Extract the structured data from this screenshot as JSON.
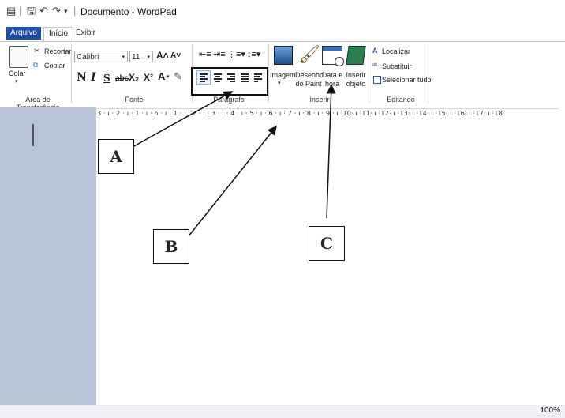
{
  "window": {
    "title": "Documento - WordPad"
  },
  "tabs": [
    {
      "label": "Arquivo"
    },
    {
      "label": "Início"
    },
    {
      "label": "Exibir"
    }
  ],
  "clipboard": {
    "paste": "Colar",
    "cut": "Recortar",
    "copy": "Copiar",
    "group": "Área de Transferência"
  },
  "font": {
    "family": "Calibri",
    "size": "11",
    "group": "Fonte",
    "bold": "N",
    "italic": "I",
    "underline": "S",
    "strike": "abc",
    "subscript": "X₂",
    "superscript": "X²"
  },
  "paragraph": {
    "group": "Parágrafo"
  },
  "insert": {
    "image": "Imagem",
    "paint": "Desenho do Paint",
    "datetime": "Data e hora",
    "object": "Inserir objeto",
    "group": "Inserir"
  },
  "editing": {
    "find": "Localizar",
    "replace": "Substituir",
    "select_all": "Selecionar tudo",
    "group": "Editando"
  },
  "ruler": {
    "text": "3 · ı · 2 · ı · 1 · ı · ⌂ · ı · 1 · ı · 2 · ı · 3 · ı · 4 · ı · 5 · ı · 6 · ı · 7 · ı · 8 · ı · 9 · ı ·10· ı ·11· ı ·12· ı ·13· ı ·14· ı ·15· ı ·16· ı ·17· ı ·18·"
  },
  "status": {
    "zoom": "100%"
  },
  "callouts": {
    "a": "A",
    "b": "B",
    "c": "C"
  }
}
